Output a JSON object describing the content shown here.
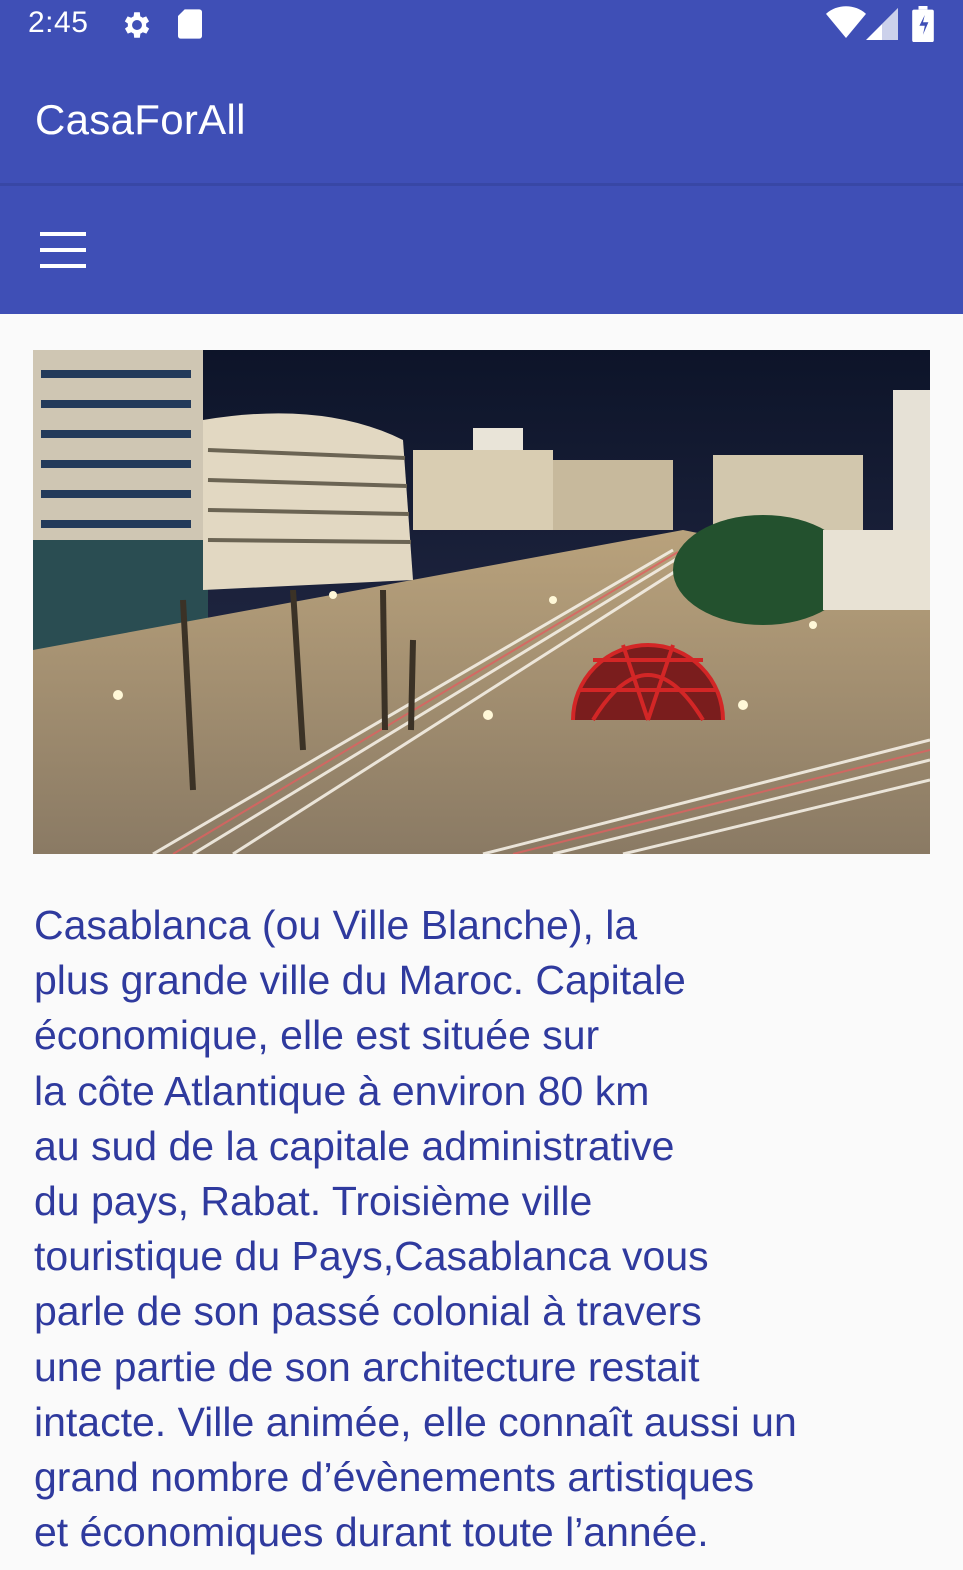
{
  "status_bar": {
    "time": "2:45",
    "icons_left": [
      "gear-icon",
      "sd-card-icon"
    ],
    "icons_right": [
      "wifi-icon",
      "signal-icon",
      "battery-icon"
    ]
  },
  "app_bar": {
    "title": "CasaForAll"
  },
  "toolbar": {
    "menu_icon": "hamburger-menu-icon"
  },
  "main": {
    "image": "Casablanca night cityscape with red dome sculpture",
    "description": "Casablanca (ou Ville Blanche), la\nplus grande ville du Maroc. Capitale\néconomique, elle est située sur\nla côte Atlantique à environ 80 km\nau sud de la capitale administrative\ndu pays, Rabat. Troisième ville\ntouristique du Pays,Casablanca vous\nparle de son passé colonial à travers\nune partie de son architecture restait\nintacte. Ville animée, elle connaît aussi un\ngrand nombre d’évènements artistiques\net économiques durant toute l’année."
  },
  "colors": {
    "primary": "#3f4fb6",
    "text": "#2f3a9e",
    "background": "#fafafa"
  }
}
